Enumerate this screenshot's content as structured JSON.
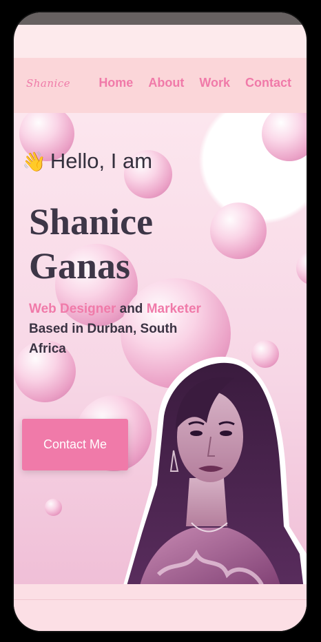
{
  "logo": {
    "text": "Shanice"
  },
  "nav": {
    "items": [
      {
        "label": "Home"
      },
      {
        "label": "About"
      },
      {
        "label": "Work"
      },
      {
        "label": "Contact"
      }
    ]
  },
  "hero": {
    "greeting_icon": "waving-hand-icon",
    "greeting": "Hello, I am",
    "name_line1": "Shanice",
    "name_line2": "Ganas",
    "tagline_part1": "Web Designer",
    "tagline_part2": " and ",
    "tagline_part3": "Marketer",
    "tagline_part4": " Based in Durban, South Africa",
    "cta_label": "Contact Me"
  },
  "colors": {
    "accent": "#f07aa9",
    "dark_text": "#3d3647",
    "nav_bg": "#fbd6d9"
  }
}
